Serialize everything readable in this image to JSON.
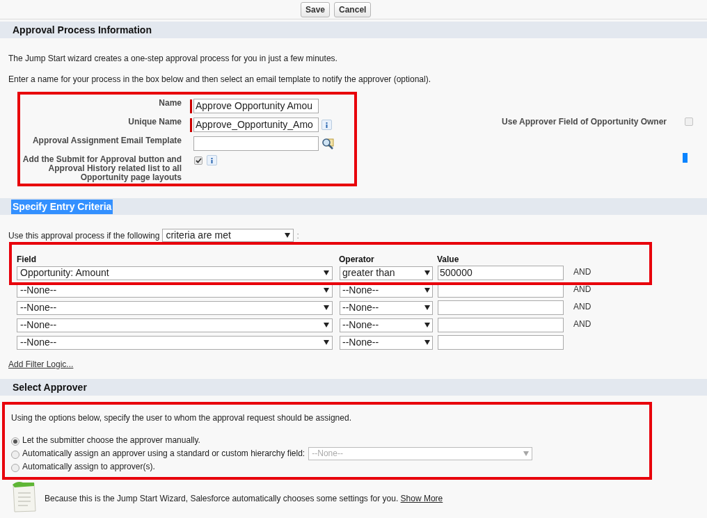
{
  "toolbar": {
    "buttons": [
      "Save",
      "Cancel"
    ]
  },
  "approval_info": {
    "title": "Approval Process Information",
    "intro": [
      "The Jump Start wizard creates a one-step approval process for you in just a few minutes.",
      "Enter a name for your process in the box below and then select an email template to notify the approver (optional)."
    ],
    "highlighted": true,
    "fields": [
      {
        "kind": "text",
        "label": "Name",
        "value": "Approve Opportunity Amou",
        "required": true,
        "info": false
      },
      {
        "kind": "text",
        "label": "Unique Name",
        "value": "Approve_Opportunity_Amo",
        "required": true,
        "info": true
      },
      {
        "kind": "lookup",
        "label": "Approval Assignment Email Template",
        "required": false,
        "info": false
      },
      {
        "kind": "checkbox",
        "label": "Add the Submit for Approval button and Approval History related list to all Opportunity page layouts",
        "checked": true,
        "info": true
      }
    ],
    "side_option": {
      "label": "Use Approver Field of Opportunity Owner",
      "checked": false
    }
  },
  "entry_criteria": {
    "title": "Specify Entry Criteria",
    "title_selected": true,
    "prompt": "Use this approval process if the following",
    "condition": "criteria are met",
    "condition_suffix": ":",
    "highlighted": true,
    "columns": [
      "Field",
      "Operator",
      "Value"
    ],
    "rows": [
      {
        "field": "Opportunity: Amount",
        "operator": "greater than",
        "value": "500000",
        "conjunction": "AND"
      },
      {
        "field": "--None--",
        "operator": "--None--",
        "conjunction": "AND"
      },
      {
        "field": "--None--",
        "operator": "--None--",
        "conjunction": "AND"
      },
      {
        "field": "--None--",
        "operator": "--None--",
        "conjunction": "AND"
      },
      {
        "field": "--None--",
        "operator": "--None--"
      }
    ],
    "link": "Add Filter Logic..."
  },
  "select_approver": {
    "title": "Select Approver",
    "instruction": "Using the options below, specify the user to whom the approval request should be assigned.",
    "highlighted": true,
    "options": [
      {
        "label": "Let the submitter choose the approver manually.",
        "selected": true
      },
      {
        "label": "Automatically assign an approver using a standard or custom hierarchy field:",
        "selected": false,
        "dropdown": {
          "value": "--None--",
          "disabled": true
        }
      },
      {
        "label": "Automatically assign to approver(s).",
        "selected": false
      }
    ]
  },
  "note": {
    "text": "Because this is the Jump Start Wizard, Salesforce automatically chooses some settings for you.",
    "link": "Show More"
  }
}
